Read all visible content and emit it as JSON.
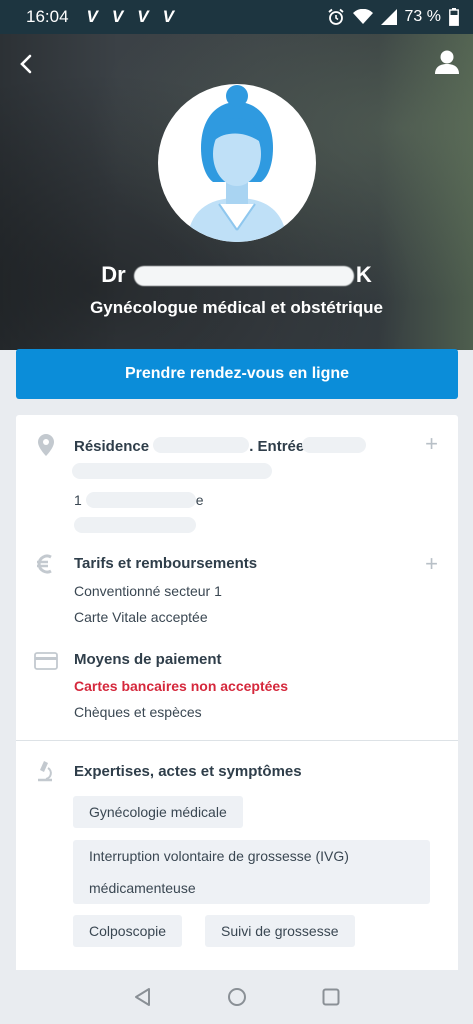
{
  "status_bar": {
    "time": "16:04",
    "notif_icons": [
      "V",
      "V",
      "V",
      "V"
    ],
    "battery": "73 %"
  },
  "header": {
    "name_prefix": "Dr",
    "name_suffix": "K",
    "specialty": "Gynécologue médical et obstétrique"
  },
  "book_button": {
    "label": "Prendre rendez-vous en ligne"
  },
  "address": {
    "title_start": "Résidence",
    "title_end": ". Entrée A2",
    "line2_start": "1",
    "line2_end": "e"
  },
  "tarifs": {
    "title": "Tarifs et remboursements",
    "lines": [
      "Conventionné secteur 1",
      "Carte Vitale acceptée"
    ]
  },
  "payment": {
    "title": "Moyens de paiement",
    "warning": "Cartes bancaires non acceptées",
    "line": "Chèques et espèces"
  },
  "expertises": {
    "title": "Expertises, actes et symptômes",
    "tags": [
      "Gynécologie médicale",
      "Interruption volontaire de grossesse (IVG) médicamenteuse",
      "Colposcopie",
      "Suivi de grossesse"
    ]
  },
  "colors": {
    "accent": "#0b8dd9",
    "warning": "#d5283c",
    "avatar_blue": "#2f9ae0"
  }
}
